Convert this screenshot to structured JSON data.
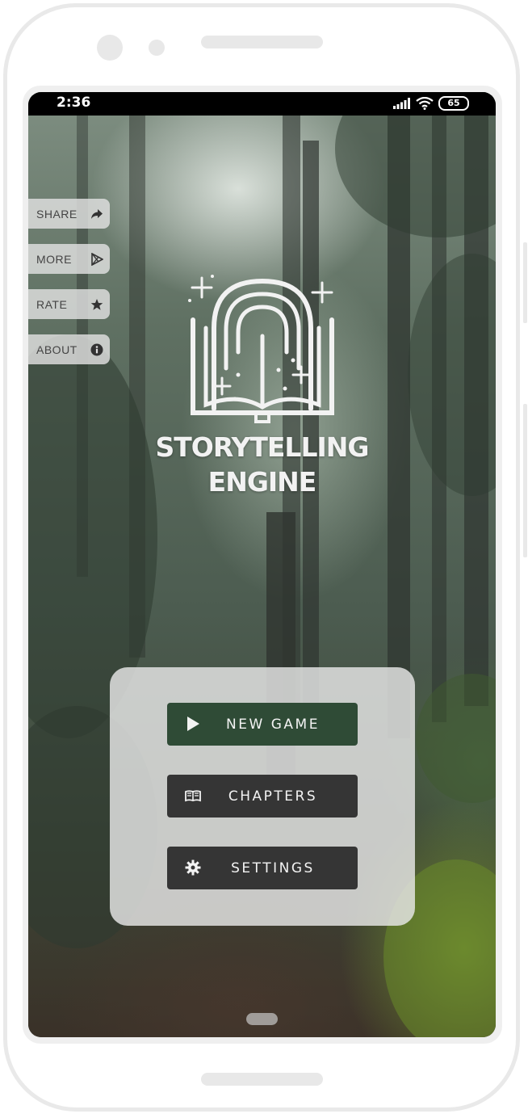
{
  "status_bar": {
    "time": "2:36",
    "battery": "65",
    "icons": [
      "signal-icon",
      "wifi-icon",
      "battery-icon"
    ]
  },
  "side_menu": {
    "items": [
      {
        "label": "SHARE",
        "icon": "share-icon"
      },
      {
        "label": "MORE",
        "icon": "play-store-icon"
      },
      {
        "label": "RATE",
        "icon": "star-icon"
      },
      {
        "label": "ABOUT",
        "icon": "info-icon"
      }
    ]
  },
  "logo": {
    "icon": "magic-book-icon",
    "title_line1": "STORYTELLING",
    "title_line2": "ENGINE"
  },
  "main_menu": {
    "new_game": {
      "label": "NEW GAME",
      "icon": "play-icon"
    },
    "chapters": {
      "label": "CHAPTERS",
      "icon": "book-icon"
    },
    "settings": {
      "label": "SETTINGS",
      "icon": "gear-icon"
    }
  },
  "colors": {
    "new_game_bg": "#2f4b36",
    "button_bg": "#353535",
    "panel_bg": "#e8e8e8"
  }
}
